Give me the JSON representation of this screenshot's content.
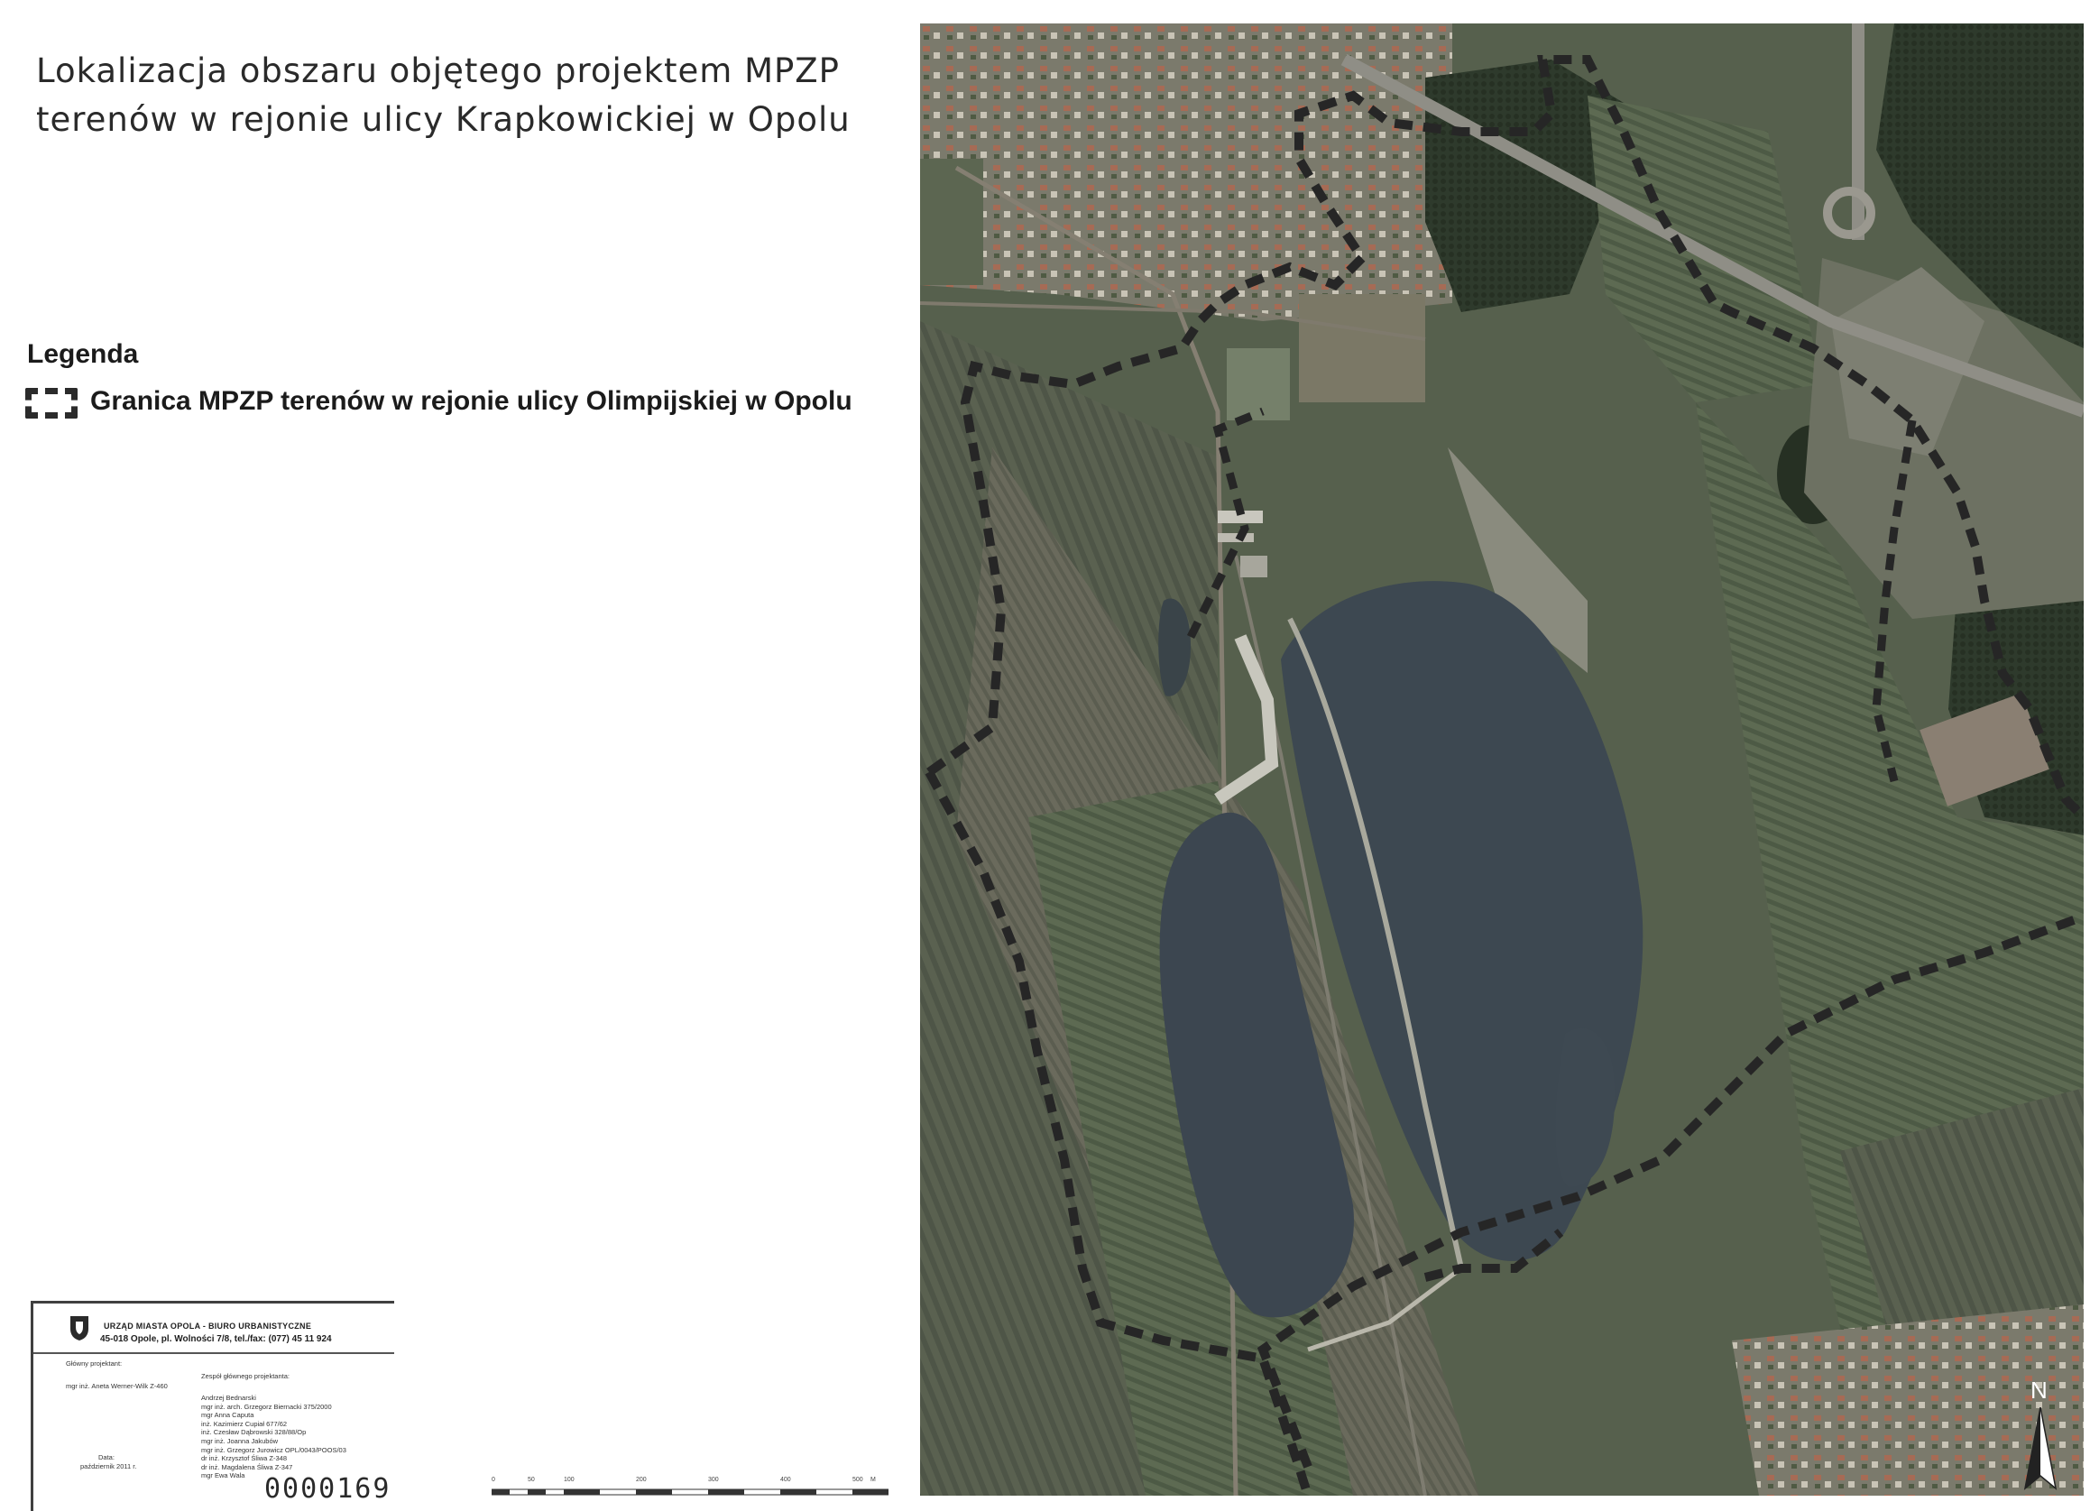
{
  "title": {
    "line1": "Lokalizacja obszaru objętego projektem MPZP",
    "line2": "terenów w rejonie ulicy Krapkowickiej w Opolu"
  },
  "legend": {
    "heading": "Legenda",
    "items": [
      {
        "symbol": "dashed-boundary-icon",
        "label": "Granica MPZP terenów w rejonie ulicy Olimpijskiej w Opolu"
      }
    ]
  },
  "stamp": {
    "org": "URZĄD MIASTA OPOLA - BIURO URBANISTYCZNE",
    "address": "45-018 Opole, pl. Wolności 7/8, tel./fax: (077) 45 11 924",
    "main_designer_label": "Główny projektant:",
    "main_designer": "mgr inż. Aneta Werner-Wilk Z-460",
    "team_label": "Zespół głównego projektanta:",
    "team": [
      "Andrzej Bednarski",
      "mgr inż. arch. Grzegorz Biernacki 375/2000",
      "mgr Anna Caputa",
      "inż. Kazimierz Cupiał 677/62",
      "inż. Czesław Dąbrowski 328/88/Op",
      "mgr inż. Joanna Jakubów",
      "mgr inż. Grzegorz Jurowicz OPL/0043/POOS/03",
      "dr inż. Krzysztof Śliwa Z-348",
      "dr inż. Magdalena Śliwa Z-347",
      "mgr Ewa Wala"
    ],
    "date_label": "Data:",
    "date": "październik 2011 r.",
    "number": "0000169"
  },
  "scale": {
    "ticks": [
      "0",
      "50",
      "100",
      "200",
      "300",
      "400",
      "500"
    ],
    "unit": "M"
  },
  "map": {
    "north_label": "N",
    "boundary_color": "#2a2a2a",
    "water_color": "#3d4851"
  }
}
